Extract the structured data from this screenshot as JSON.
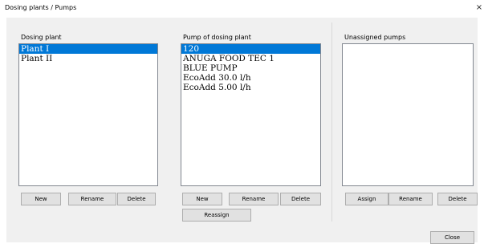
{
  "window": {
    "title": "Dosing plants / Pumps",
    "close_glyph": "×",
    "close_icon": "close-icon"
  },
  "dosing_plant": {
    "label": "Dosing plant",
    "items": [
      {
        "label": "Plant I",
        "selected": true
      },
      {
        "label": "Plant II",
        "selected": false
      }
    ],
    "buttons": {
      "new": "New",
      "rename": "Rename",
      "delete": "Delete"
    }
  },
  "pump_of_dosing_plant": {
    "label": "Pump of dosing plant",
    "items": [
      {
        "label": "120",
        "selected": true
      },
      {
        "label": "ANUGA FOOD TEC 1",
        "selected": false
      },
      {
        "label": "BLUE PUMP",
        "selected": false
      },
      {
        "label": "EcoAdd 30.0 l/h",
        "selected": false
      },
      {
        "label": "EcoAdd 5.00 l/h",
        "selected": false
      }
    ],
    "buttons": {
      "new": "New",
      "rename": "Rename",
      "delete": "Delete",
      "reassign": "Reassign"
    }
  },
  "unassigned_pumps": {
    "label": "Unassigned pumps",
    "items": [],
    "buttons": {
      "assign": "Assign",
      "rename": "Rename",
      "delete": "Delete"
    }
  },
  "footer": {
    "close": "Close"
  },
  "colors": {
    "selection": "#0078d7",
    "dialog_bg": "#f0f0f0",
    "button_bg": "#e1e1e1"
  }
}
